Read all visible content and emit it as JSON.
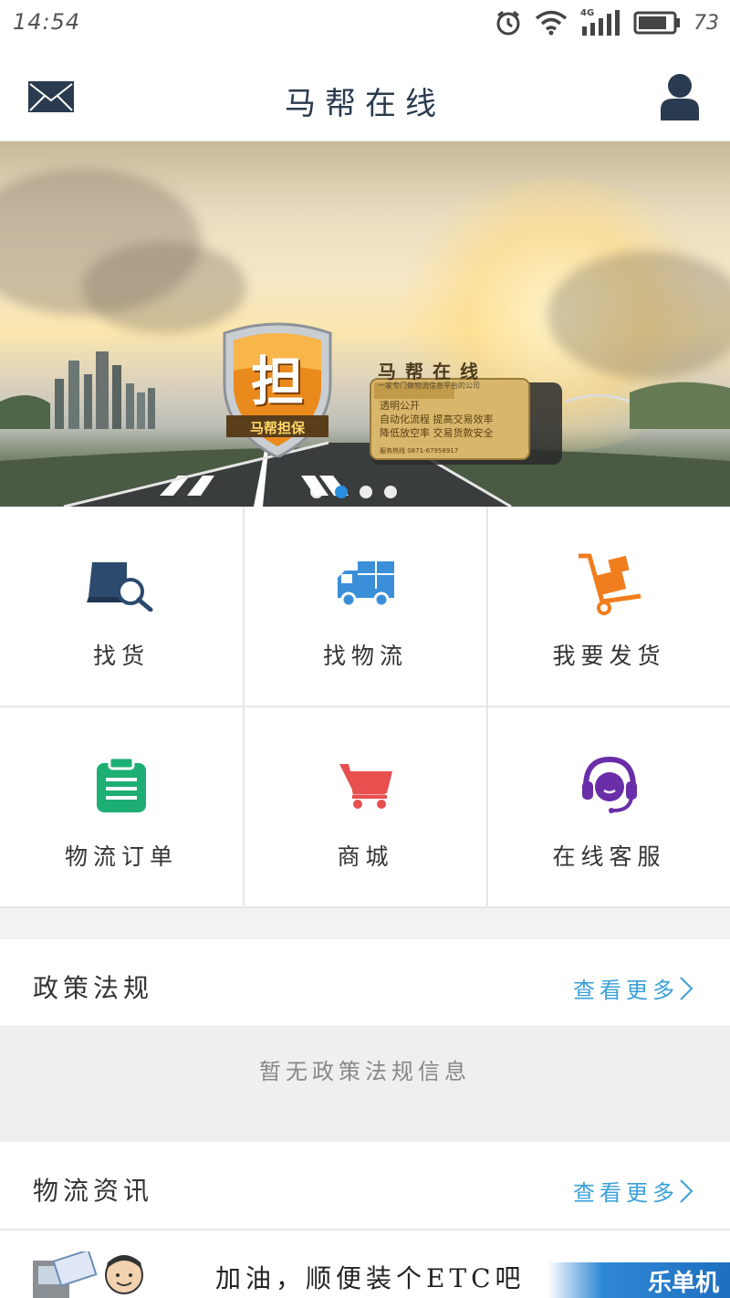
{
  "status_bar": {
    "time": "14:54",
    "network": "4G",
    "battery": "73"
  },
  "header": {
    "title": "马帮在线",
    "mail_icon": "mail-icon",
    "user_icon": "user-icon"
  },
  "banner": {
    "badge_text": "担",
    "badge_ribbon": "马帮担保",
    "brand": "马帮在线",
    "brand_sub": "一家专门做物流信息平台的公司",
    "card_line1": "透明公开",
    "card_line2": "自动化流程 提高交易效率",
    "card_line3": "降低放空率 交易货款安全",
    "card_phone": "服务热线 0871-67958917",
    "dots_total": 4,
    "dots_active_index": 1
  },
  "menu": [
    {
      "label": "找货",
      "icon": "find-goods-icon",
      "color": "#2b4a6e"
    },
    {
      "label": "找物流",
      "icon": "truck-icon",
      "color": "#3b8fd8"
    },
    {
      "label": "我要发货",
      "icon": "hand-cart-icon",
      "color": "#f07e1e"
    },
    {
      "label": "物流订单",
      "icon": "clipboard-icon",
      "color": "#1cae73"
    },
    {
      "label": "商城",
      "icon": "shopping-cart-icon",
      "color": "#e84f4f"
    },
    {
      "label": "在线客服",
      "icon": "headset-icon",
      "color": "#6a2ea8"
    }
  ],
  "policy": {
    "title": "政策法规",
    "more": "查看更多",
    "empty_text": "暂无政策法规信息"
  },
  "logistics_news": {
    "title": "物流资讯",
    "more": "查看更多",
    "items": [
      {
        "headline": "加油，顺便装个ETC吧",
        "badge": "乐单机"
      }
    ]
  },
  "colors": {
    "accent_blue": "#3aa0d8",
    "title_navy": "#2a3b4f"
  }
}
